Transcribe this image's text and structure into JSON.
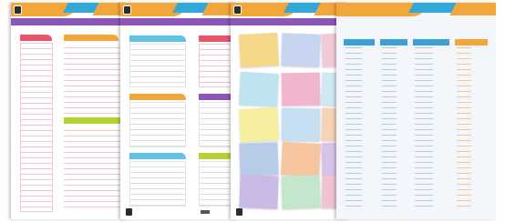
{
  "colors": {
    "orange": "#f3a63a",
    "blue": "#31a8d8",
    "purple": "#8b56b8",
    "pink": "#e8556b",
    "green": "#b6d334",
    "cyan": "#5fc2e6",
    "table_header": "#3aa0d6",
    "vocab_title": "#2d7ec0"
  },
  "pages": [
    {
      "header_text": "",
      "col_left_label": "",
      "col_right_label": "",
      "mid_label": ""
    },
    {
      "header_text": ""
    },
    {
      "header_text": ""
    },
    {
      "title": "",
      "subtitle": ""
    }
  ],
  "sticky_note_colors": [
    "#f5d78a",
    "#c7d5f1",
    "#f2c9d6",
    "#bfe3ef",
    "#f1b6cd",
    "#cfe8f2",
    "#f6efa0",
    "#c6dff2",
    "#f6d2b6",
    "#b8cbe9",
    "#f7c6a0",
    "#d7c2e8",
    "#c9b9e6",
    "#c4e6cc",
    "#f0c3d3"
  ],
  "icons": {
    "logo": "logo-icon",
    "footer": "footer-logo-icon"
  }
}
